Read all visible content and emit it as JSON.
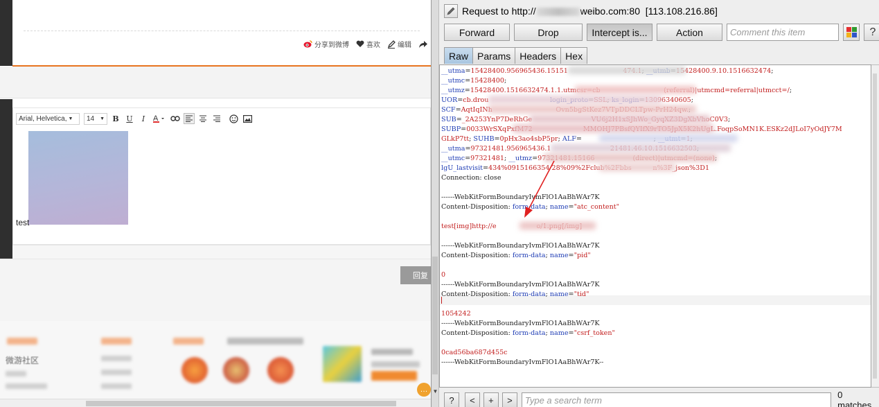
{
  "webpage": {
    "share_actions": [
      {
        "icon": "weibo-icon",
        "label": "分享到微博"
      },
      {
        "icon": "heart-icon",
        "label": "喜欢"
      },
      {
        "icon": "edit-icon",
        "label": "编辑"
      }
    ],
    "editor": {
      "font_family": "Arial, Helvetica,",
      "font_size": "14",
      "text": "test"
    },
    "reply_button": "回复",
    "footer_label": "微游社区"
  },
  "burp": {
    "title": {
      "prefix": "Request to http://",
      "host_suffix": "weibo.com:80",
      "ip": "[113.108.216.86]"
    },
    "buttons": {
      "forward": "Forward",
      "drop": "Drop",
      "intercept": "Intercept is...",
      "action": "Action"
    },
    "comment_placeholder": "Comment this item",
    "help": "?",
    "tabs": [
      "Raw",
      "Params",
      "Headers",
      "Hex"
    ],
    "request_lines": [
      [
        [
          "k",
          "__utma"
        ],
        [
          "s",
          "="
        ],
        [
          "v",
          "15428400.956965436.15151"
        ],
        [
          "g",
          "                          "
        ],
        [
          "v",
          "474.1"
        ],
        [
          "s",
          "; "
        ],
        [
          "k",
          "__utmb"
        ],
        [
          "s",
          "="
        ],
        [
          "v",
          "15428400.9.10.1516632474"
        ],
        [
          "s",
          ";"
        ]
      ],
      [
        [
          "k",
          "__utmc"
        ],
        [
          "s",
          "="
        ],
        [
          "v",
          "15428400"
        ],
        [
          "s",
          ";"
        ]
      ],
      [
        [
          "k",
          "__utmz"
        ],
        [
          "s",
          "="
        ],
        [
          "v",
          "15428400.1516632474.1.1.utmcsr=cb"
        ],
        [
          "g",
          "                              "
        ],
        [
          "v",
          "(referral)|utmcmd=referral|utmcct=/"
        ],
        [
          "s",
          ";"
        ]
      ],
      [
        [
          "k",
          "UOR"
        ],
        [
          "s",
          "="
        ],
        [
          "v",
          "cb.drou"
        ],
        [
          "g",
          "                             "
        ],
        [
          "k",
          "login_proto"
        ],
        [
          "s",
          "="
        ],
        [
          "v",
          "SSL"
        ],
        [
          "s",
          "; "
        ],
        [
          "k",
          "ks_login"
        ],
        [
          "s",
          "="
        ],
        [
          "v",
          "13096340605"
        ],
        [
          "s",
          ";"
        ]
      ],
      [
        [
          "k",
          "SCF"
        ],
        [
          "s",
          "="
        ],
        [
          "v",
          "AqtIqINh"
        ],
        [
          "g",
          "                              "
        ],
        [
          "v",
          "Ovn5bgStKez7VTpDDCLTpw-PrH24qw."
        ],
        [
          "s",
          ";"
        ]
      ],
      [
        [
          "k",
          "SUB"
        ],
        [
          "s",
          "="
        ],
        [
          "v",
          "_2A253YnP7DeRhGe"
        ],
        [
          "g",
          "                            "
        ],
        [
          "v",
          "VU6j2H1xSJhWo_GyqXZ3DgXbVhoC0V3"
        ],
        [
          "s",
          ";"
        ]
      ],
      [
        [
          "k",
          "SUBP"
        ],
        [
          "s",
          "="
        ],
        [
          "v",
          "0033WrSXqPxfM72"
        ],
        [
          "g",
          "                        "
        ],
        [
          "v",
          "MMOHJ7PBsfQYIfX9rTO5JpX5K2hUgL.FoqpSoMN1K.ESKz2dJLoI7yOdJY7M"
        ]
      ],
      [
        [
          "v",
          "GLkP7tt"
        ],
        [
          "s",
          "; "
        ],
        [
          "k",
          "SUHB"
        ],
        [
          "s",
          "="
        ],
        [
          "v",
          "0pHx3ao4sbP5pr"
        ],
        [
          "s",
          "; "
        ],
        [
          "k",
          "ALF"
        ],
        [
          "s",
          "="
        ],
        [
          "g",
          "                                  "
        ],
        [
          "s",
          "; "
        ],
        [
          "k",
          "__utmt"
        ],
        [
          "s",
          "="
        ],
        [
          "v",
          "1"
        ],
        [
          "s",
          ";"
        ]
      ],
      [
        [
          "k",
          "__utma"
        ],
        [
          "s",
          "="
        ],
        [
          "v",
          "97321481.956965436.1"
        ],
        [
          "g",
          "                            "
        ],
        [
          "v",
          "21481.46.10.1516632503"
        ],
        [
          "s",
          ";"
        ]
      ],
      [
        [
          "k",
          "__utmc"
        ],
        [
          "s",
          "="
        ],
        [
          "v",
          "97321481"
        ],
        [
          "s",
          "; "
        ],
        [
          "k",
          "__utmz"
        ],
        [
          "s",
          "="
        ],
        [
          "v",
          "97321481.15166"
        ],
        [
          "g",
          "                  "
        ],
        [
          "v",
          "(direct)|utmcmd=(none)"
        ],
        [
          "s",
          ";"
        ]
      ],
      [
        [
          "k",
          "lgU_lastvisit"
        ],
        [
          "s",
          "="
        ],
        [
          "v",
          "434%0915166354 28%09%2Fclub%2Fbbs"
        ],
        [
          "g",
          "          "
        ],
        [
          "v",
          "n%3F_json%3D1"
        ]
      ],
      [
        [
          "g",
          "Connection: close"
        ]
      ],
      [],
      [
        [
          "g",
          "------WebKitFormBoundaryIvmFlO1AaBhWAr7K"
        ]
      ],
      [
        [
          "g",
          "Content-Disposition: "
        ],
        [
          "k",
          "form-data"
        ],
        [
          "s",
          "; "
        ],
        [
          "k",
          "name"
        ],
        [
          "s",
          "="
        ],
        [
          "v",
          "\"atc_content\""
        ]
      ],
      [],
      [
        [
          "v",
          "test[img]http://e"
        ],
        [
          "g",
          "                   "
        ],
        [
          "v",
          "o/1.png[/img]"
        ]
      ],
      [],
      [
        [
          "g",
          "------WebKitFormBoundaryIvmFlO1AaBhWAr7K"
        ]
      ],
      [
        [
          "g",
          "Content-Disposition: "
        ],
        [
          "k",
          "form-data"
        ],
        [
          "s",
          "; "
        ],
        [
          "k",
          "name"
        ],
        [
          "s",
          "="
        ],
        [
          "v",
          "\"pid\""
        ]
      ],
      [],
      [
        [
          "v",
          "0"
        ]
      ],
      [
        [
          "g",
          "------WebKitFormBoundaryIvmFlO1AaBhWAr7K"
        ]
      ],
      [
        [
          "g",
          "Content-Disposition: "
        ],
        [
          "k",
          "form-data"
        ],
        [
          "s",
          "; "
        ],
        [
          "k",
          "name"
        ],
        [
          "s",
          "="
        ],
        [
          "v",
          "\"tid\""
        ]
      ],
      [],
      [
        [
          "v",
          "1054242"
        ]
      ],
      [
        [
          "g",
          "------WebKitFormBoundaryIvmFlO1AaBhWAr7K"
        ]
      ],
      [
        [
          "g",
          "Content-Disposition: "
        ],
        [
          "k",
          "form-data"
        ],
        [
          "s",
          "; "
        ],
        [
          "k",
          "name"
        ],
        [
          "s",
          "="
        ],
        [
          "v",
          "\"csrf_token\""
        ]
      ],
      [],
      [
        [
          "v",
          "0cad56ba687d455c"
        ]
      ],
      [
        [
          "g",
          "------WebKitFormBoundaryIvmFlO1AaBhWAr7K--"
        ]
      ]
    ],
    "search": {
      "help": "?",
      "prev": "<",
      "add": "+",
      "next": ">",
      "placeholder": "Type a search term",
      "matches": "0 matches"
    },
    "colors": {
      "key": "#1e3cb4",
      "value": "#c21d1d",
      "selected_tab": "#a9c6e0",
      "annotation_arrow": "#e02020"
    }
  }
}
